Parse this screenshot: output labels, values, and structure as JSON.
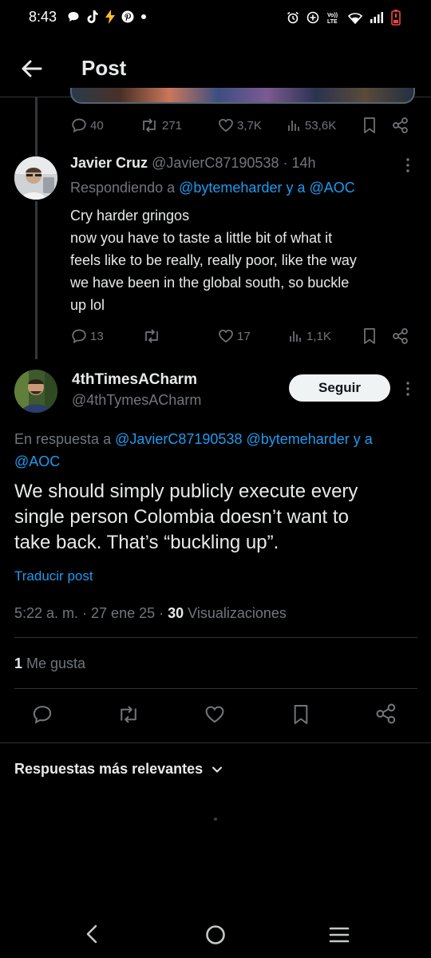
{
  "status_bar": {
    "time": "8:43",
    "left_icons": [
      "chat-bubble-icon",
      "tiktok-icon",
      "bolt-icon",
      "pinterest-icon",
      "dot-icon"
    ],
    "right_icons": [
      "alarm-icon",
      "add-circle-icon",
      "volte-icon",
      "wifi-icon",
      "signal-icon",
      "battery-icon"
    ]
  },
  "header": {
    "title": "Post"
  },
  "parent_post": {
    "replies": "40",
    "reposts": "271",
    "likes": "3,7K",
    "views": "53,6K"
  },
  "reply": {
    "name": "Javier Cruz",
    "handle": "@JavierC87190538",
    "time": "· 14h",
    "replying_prefix": "Respondiendo a",
    "replying_users": "@bytemeharder y a @AOC",
    "text_lines": [
      "Cry harder gringos",
      "now you have to taste a little bit of what it",
      "feels like to be really, really poor, like the way",
      "we have been in the global south, so buckle",
      "up lol"
    ],
    "replies": "13",
    "likes": "17",
    "views": "1,1K"
  },
  "main_post": {
    "name": "4thTimesACharm",
    "handle": "@4thTymesACharm",
    "follow_label": "Seguir",
    "reply_prefix": "En respuesta a",
    "reply_users_line1": "@JavierC87190538 @bytemeharder y a",
    "reply_users_line2": "@AOC",
    "text_lines": [
      "We should simply publicly execute every",
      "single person Colombia doesn’t want to",
      "take back. That’s “buckling up”."
    ],
    "translate": "Traducir post",
    "timestamp": "5:22 a. m. · 27 ene 25 · ",
    "views_count": "30",
    "views_label": " Visualizaciones",
    "likes_count": "1",
    "likes_label": " Me gusta"
  },
  "replies_sort": {
    "label": "Respuestas más relevantes"
  },
  "colors": {
    "accent": "#1d9bf0",
    "background": "#000000",
    "text": "#e7e9ea",
    "muted": "#71767b",
    "border": "#2f3336"
  }
}
